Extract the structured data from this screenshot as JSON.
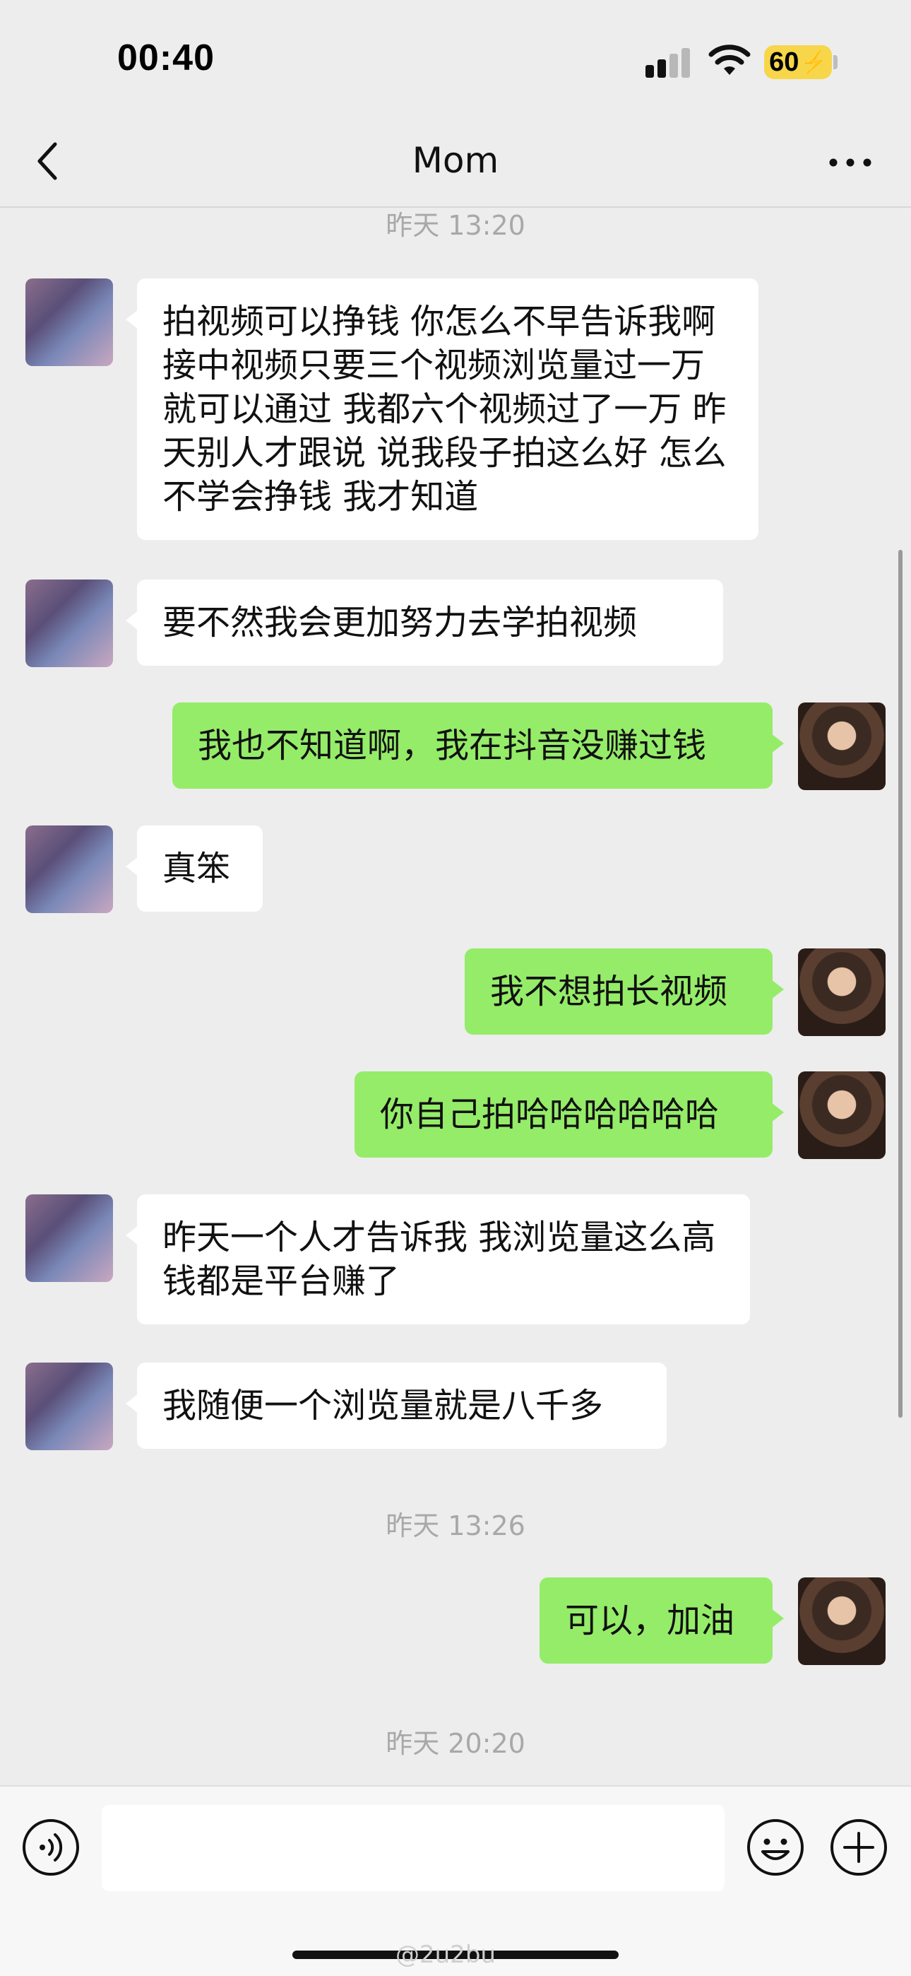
{
  "status_bar": {
    "time": "00:40",
    "battery": "60"
  },
  "header": {
    "title": "Mom"
  },
  "chat": {
    "timestamps": [
      "昨天 13:20",
      "昨天 13:26",
      "昨天 20:20"
    ],
    "messages": [
      {
        "side": "left",
        "text": "拍视频可以挣钱 你怎么不早告诉我啊 接中视频只要三个视频浏览量过一万就可以通过 我都六个视频过了一万 昨天别人才跟说 说我段子拍这么好 怎么不学会挣钱 我才知道"
      },
      {
        "side": "left",
        "text": "要不然我会更加努力去学拍视频"
      },
      {
        "side": "right",
        "text": "我也不知道啊，我在抖音没赚过钱"
      },
      {
        "side": "left",
        "text": "真笨"
      },
      {
        "side": "right",
        "text": "我不想拍长视频"
      },
      {
        "side": "right",
        "text": "你自己拍哈哈哈哈哈哈"
      },
      {
        "side": "left",
        "text": "昨天一个人才告诉我 我浏览量这么高钱都是平台赚了"
      },
      {
        "side": "left",
        "text": "我随便一个浏览量就是八千多"
      },
      {
        "side": "right",
        "text": "可以，加油"
      }
    ]
  },
  "input": {
    "value": ""
  },
  "watermark": "@2u2bu",
  "colors": {
    "sent_bubble": "#95ec69",
    "received_bubble": "#ffffff",
    "background": "#ededed",
    "battery": "#f7d64a"
  }
}
